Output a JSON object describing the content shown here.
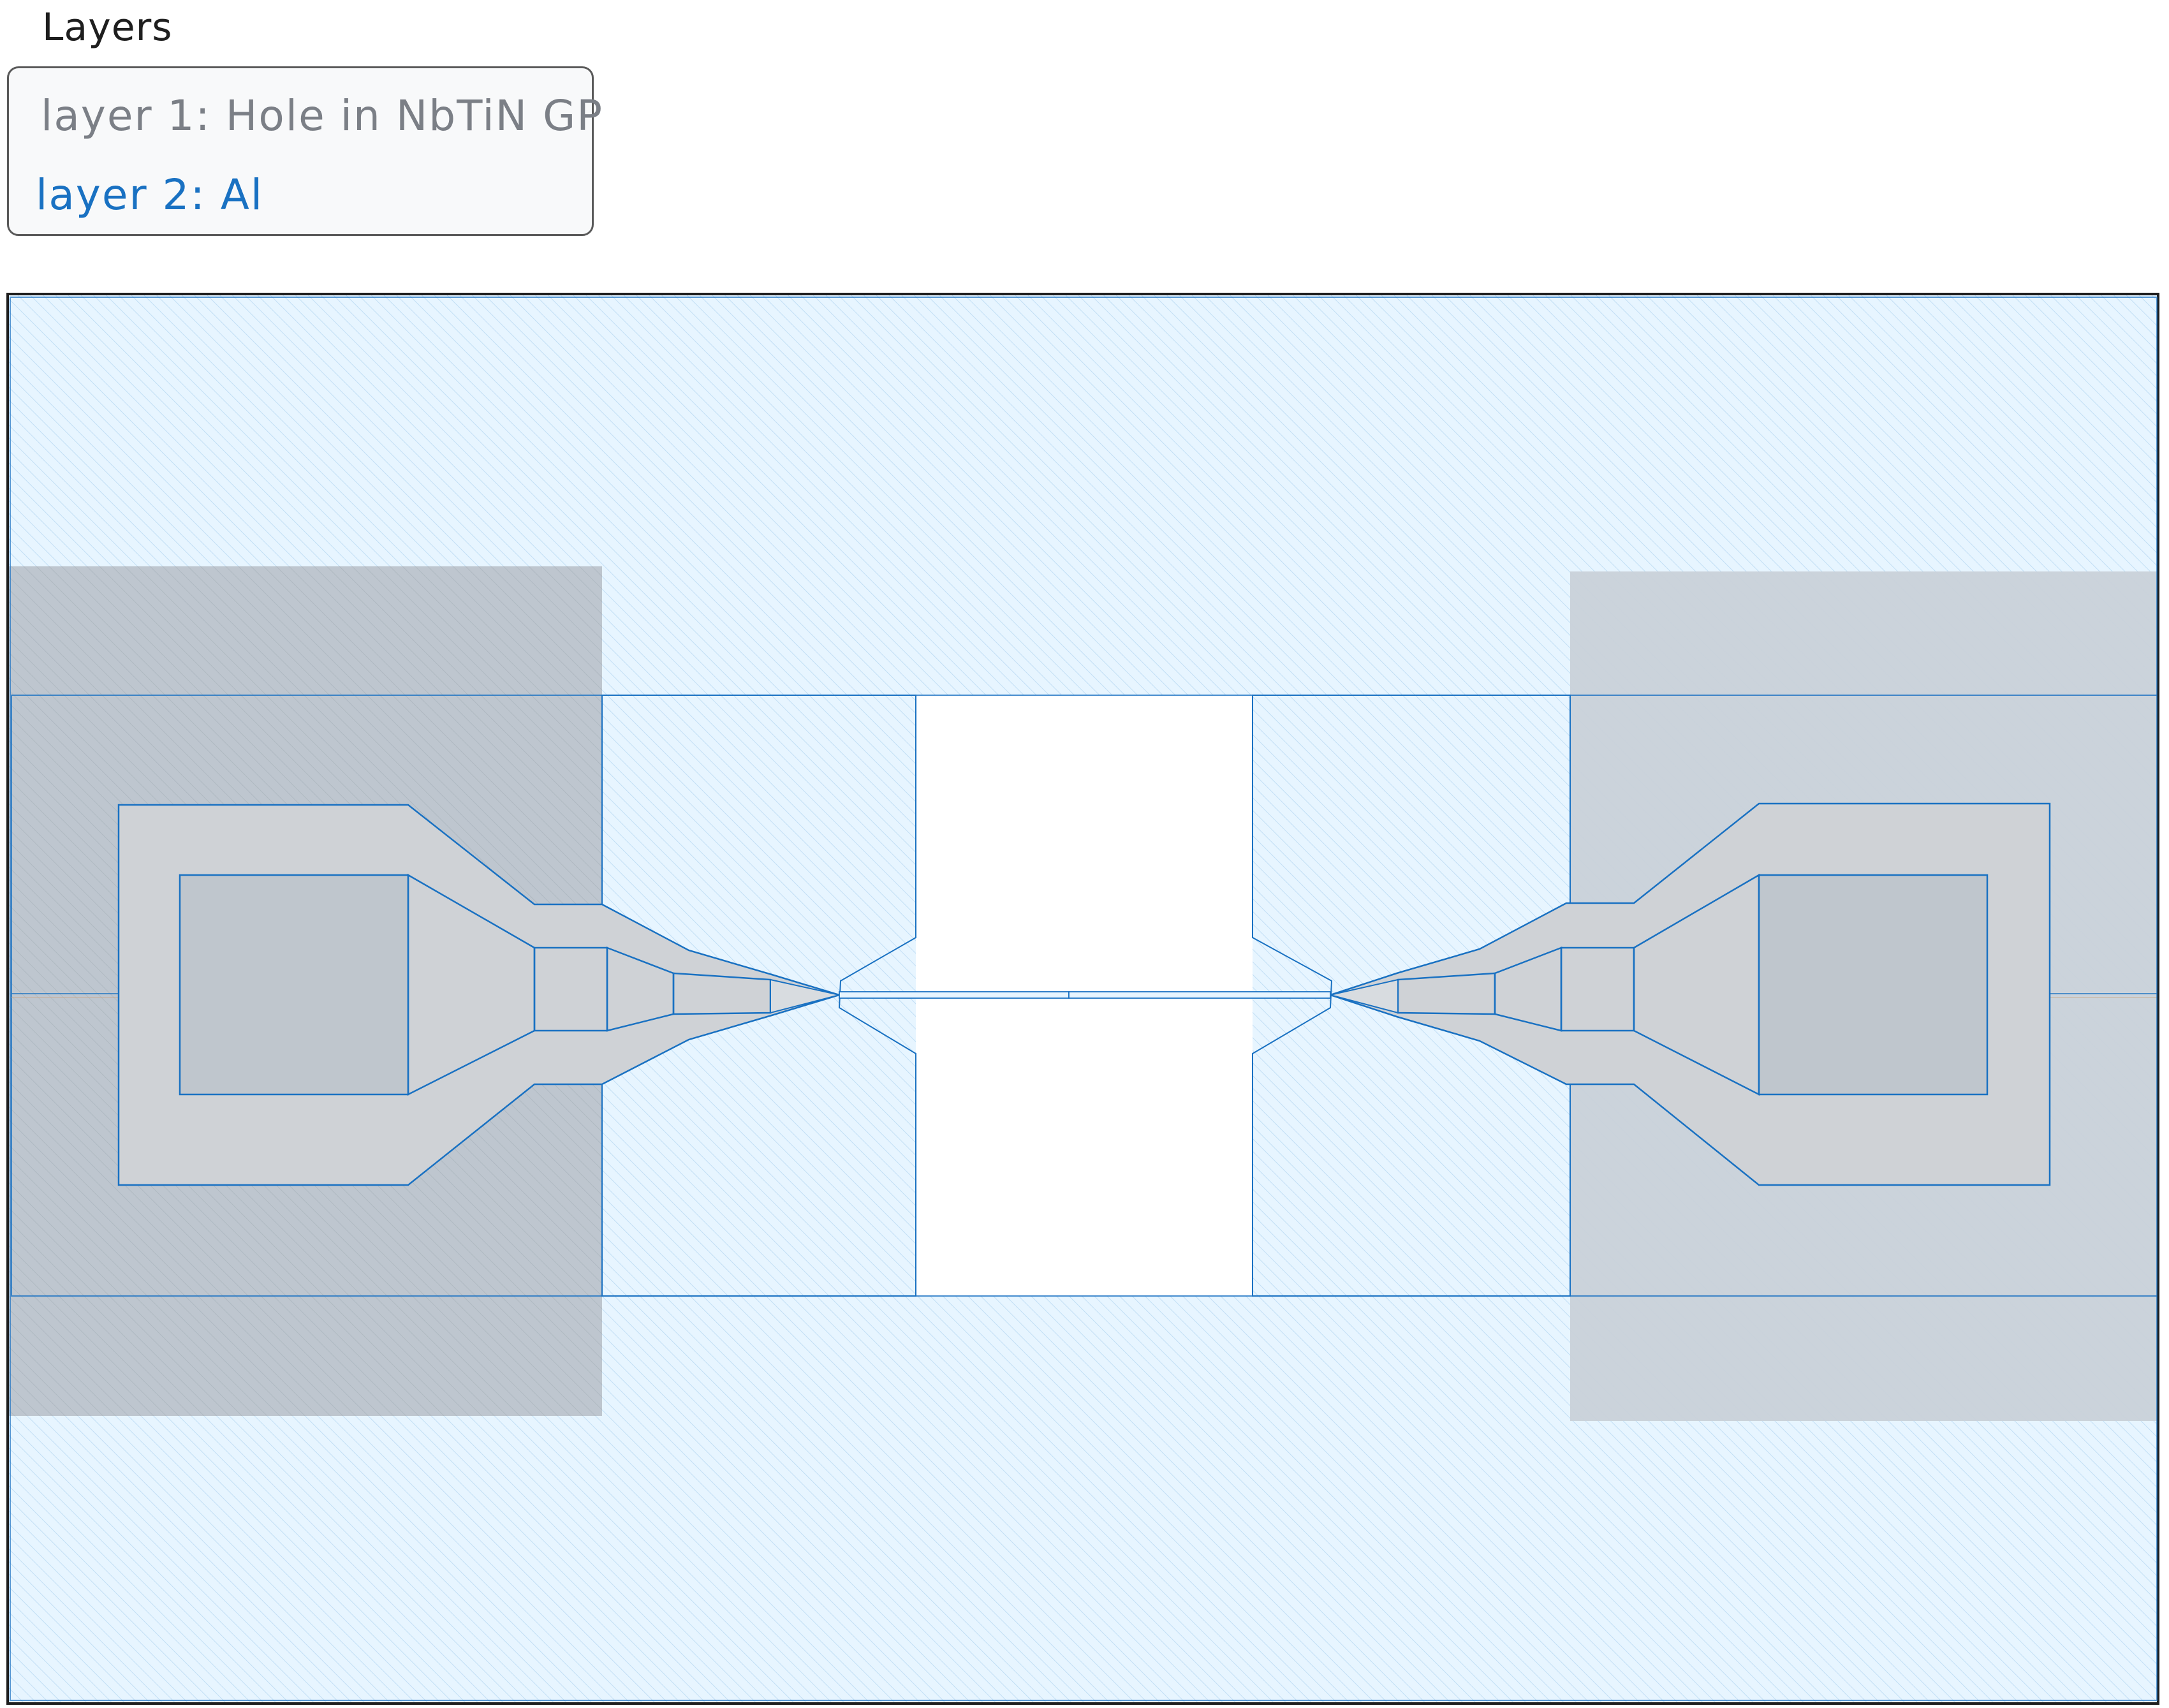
{
  "title": "Layers",
  "legend": {
    "layer1": "layer 1: Hole in NbTiN GP",
    "layer2": "layer 2: Al"
  },
  "colors": {
    "al_fill": "#e7f5ff",
    "al_stroke": "#1971c2",
    "hole_fill": "#cfd2d6",
    "pad_fill": "#bcc4cc",
    "outline": "#1e1e1e",
    "legend_gray": "#7b7f86"
  }
}
